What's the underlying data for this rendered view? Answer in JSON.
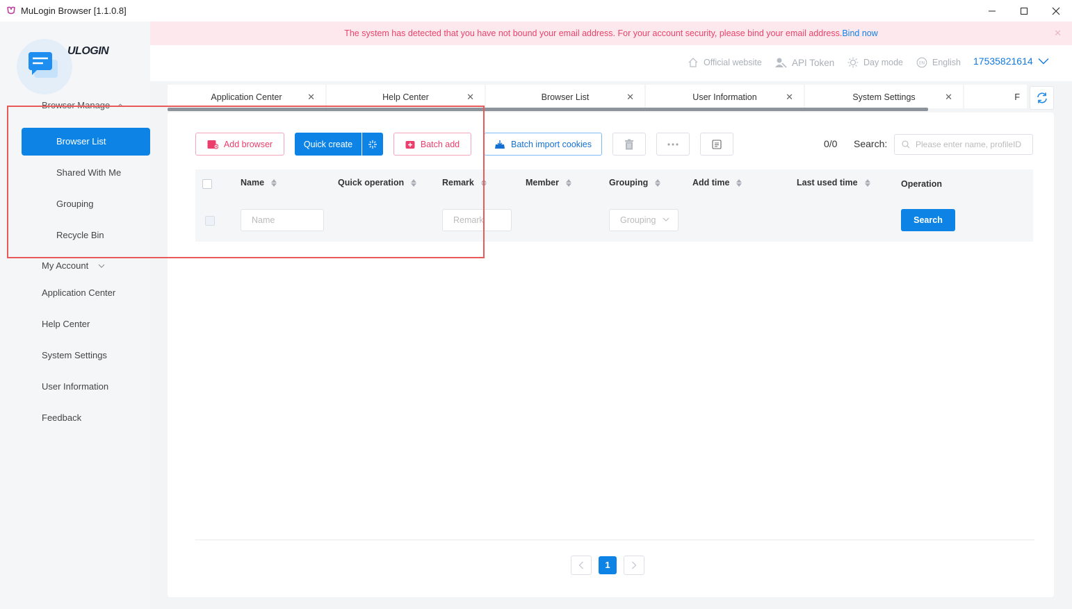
{
  "window": {
    "title": "MuLogin Browser  [1.1.0.8]"
  },
  "notice": {
    "text": "The system has detected that you have not bound your email address. For your account security, please bind your email address.",
    "link": "Bind now"
  },
  "header": {
    "official": "Official website",
    "api": "API Token",
    "day": "Day mode",
    "lang": "English",
    "user": "17535821614"
  },
  "sidebar": {
    "logo": "ULOGIN",
    "group_browser": "Browser Manage",
    "browser_list": "Browser List",
    "shared": "Shared With Me",
    "grouping": "Grouping",
    "recycle": "Recycle Bin",
    "my_account": "My Account",
    "app_center": "Application Center",
    "help": "Help Center",
    "system": "System Settings",
    "user_info": "User Information",
    "feedback": "Feedback"
  },
  "tabs": [
    {
      "label": "Application Center"
    },
    {
      "label": "Help Center"
    },
    {
      "label": "Browser List"
    },
    {
      "label": "User Information"
    },
    {
      "label": "System Settings"
    },
    {
      "label": "F"
    }
  ],
  "toolbar": {
    "add_browser": "Add browser",
    "quick_create": "Quick create",
    "batch_add": "Batch add",
    "batch_import": "Batch import cookies",
    "count": "0/0",
    "search_label": "Search:",
    "search_placeholder": "Please enter name, profileID"
  },
  "table": {
    "columns": [
      "Name",
      "Quick operation",
      "Remark",
      "Member",
      "Grouping",
      "Add time",
      "Last used time",
      "Operation"
    ],
    "filters": {
      "name_placeholder": "Name",
      "remark_placeholder": "Remark",
      "grouping_placeholder": "Grouping",
      "search_button": "Search"
    }
  },
  "pagination": {
    "current": "1"
  },
  "colors": {
    "primary": "#0d84e5",
    "pink": "#ec3e6c",
    "highlight": "#e85a5a"
  }
}
